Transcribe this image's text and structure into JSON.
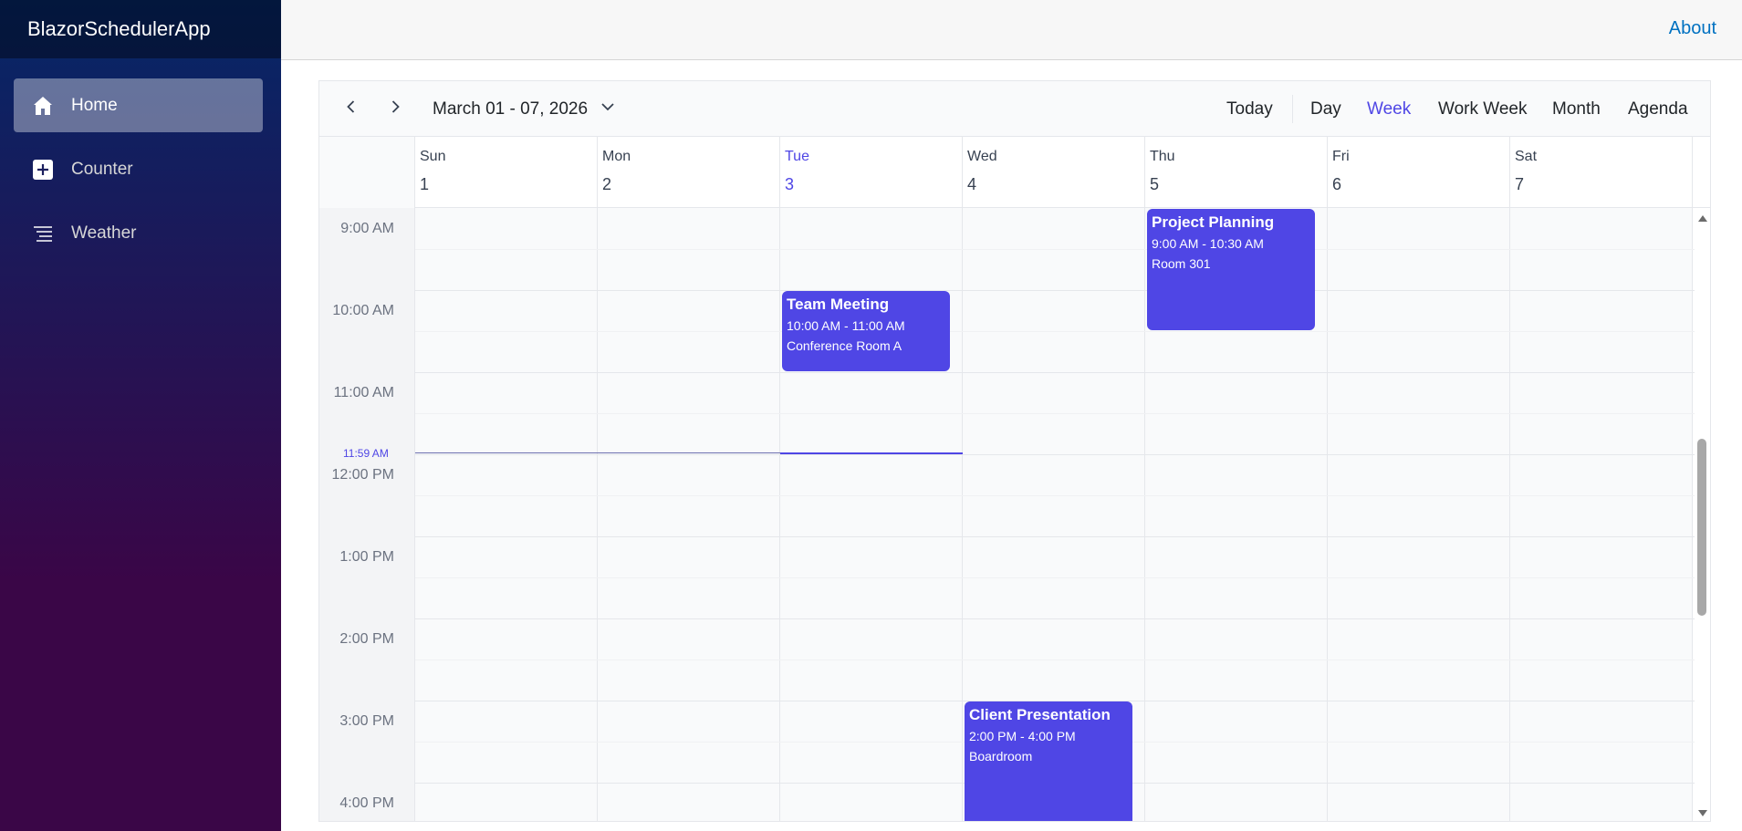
{
  "app": {
    "brand": "BlazorSchedulerApp"
  },
  "sidebar": {
    "items": [
      {
        "label": "Home",
        "icon": "home-icon",
        "active": true
      },
      {
        "label": "Counter",
        "icon": "plus-square-icon",
        "active": false
      },
      {
        "label": "Weather",
        "icon": "list-icon",
        "active": false
      }
    ]
  },
  "topbar": {
    "about": "About"
  },
  "scheduler": {
    "date_range": "March 01 - 07, 2026",
    "today_button": "Today",
    "views": [
      "Day",
      "Week",
      "Work Week",
      "Month",
      "Agenda"
    ],
    "active_view": "Week",
    "days": [
      {
        "name": "Sun",
        "num": "1"
      },
      {
        "name": "Mon",
        "num": "2"
      },
      {
        "name": "Tue",
        "num": "3",
        "today": true
      },
      {
        "name": "Wed",
        "num": "4"
      },
      {
        "name": "Thu",
        "num": "5"
      },
      {
        "name": "Fri",
        "num": "6"
      },
      {
        "name": "Sat",
        "num": "7"
      }
    ],
    "times": [
      "9:00 AM",
      "10:00 AM",
      "11:00 AM",
      "12:00 PM",
      "1:00 PM",
      "2:00 PM",
      "3:00 PM",
      "4:00 PM"
    ],
    "now_label": "11:59 AM",
    "events": [
      {
        "title": "Project Planning",
        "time": "9:00 AM - 10:30 AM",
        "location": "Room 301",
        "day": "Thu"
      },
      {
        "title": "Team Meeting",
        "time": "10:00 AM - 11:00 AM",
        "location": "Conference Room A",
        "day": "Tue"
      },
      {
        "title": "Client Presentation",
        "time": "2:00 PM - 4:00 PM",
        "location": "Boardroom",
        "day": "Wed"
      }
    ]
  },
  "colors": {
    "accent": "#4f46e5",
    "link": "#0071c1"
  }
}
